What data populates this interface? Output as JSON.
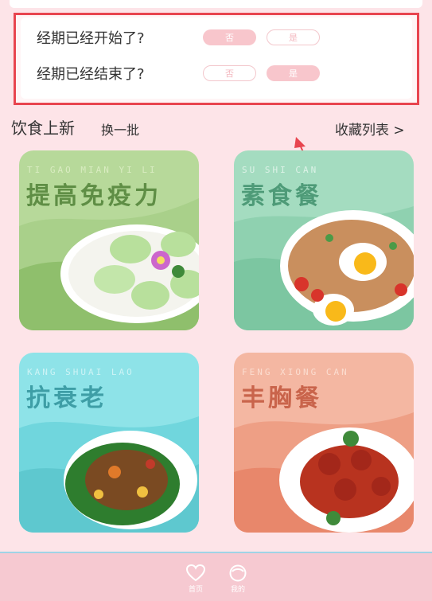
{
  "period": {
    "q1": "经期已经开始了?",
    "q1_options": [
      "否",
      "是"
    ],
    "q1_selected": "否",
    "q2": "经期已经结束了?",
    "q2_options": [
      "否",
      "是"
    ],
    "q2_selected": "是"
  },
  "diet": {
    "title": "饮食上新",
    "refresh": "换一批",
    "favorites": "收藏列表 >"
  },
  "tiles": [
    {
      "pinyin": "TI GAO MIAN YI LI",
      "title": "提高免疫力",
      "theme": "#9cc77c"
    },
    {
      "pinyin": "SU SHI CAN",
      "title": "素食餐",
      "theme": "#7fcba4"
    },
    {
      "pinyin": "KANG SHUAI LAO",
      "title": "抗衰老",
      "theme": "#66d4dc"
    },
    {
      "pinyin": "FENG XIONG CAN",
      "title": "丰胸餐",
      "theme": "#ee9a86"
    }
  ],
  "tabbar": {
    "home": "首页",
    "mine": "我的",
    "home_icon": "heart-icon",
    "mine_icon": "face-icon"
  },
  "colors": {
    "background": "#fde4e8",
    "highlight_border": "#e8454f",
    "option_selected": "#f8c6cc"
  }
}
